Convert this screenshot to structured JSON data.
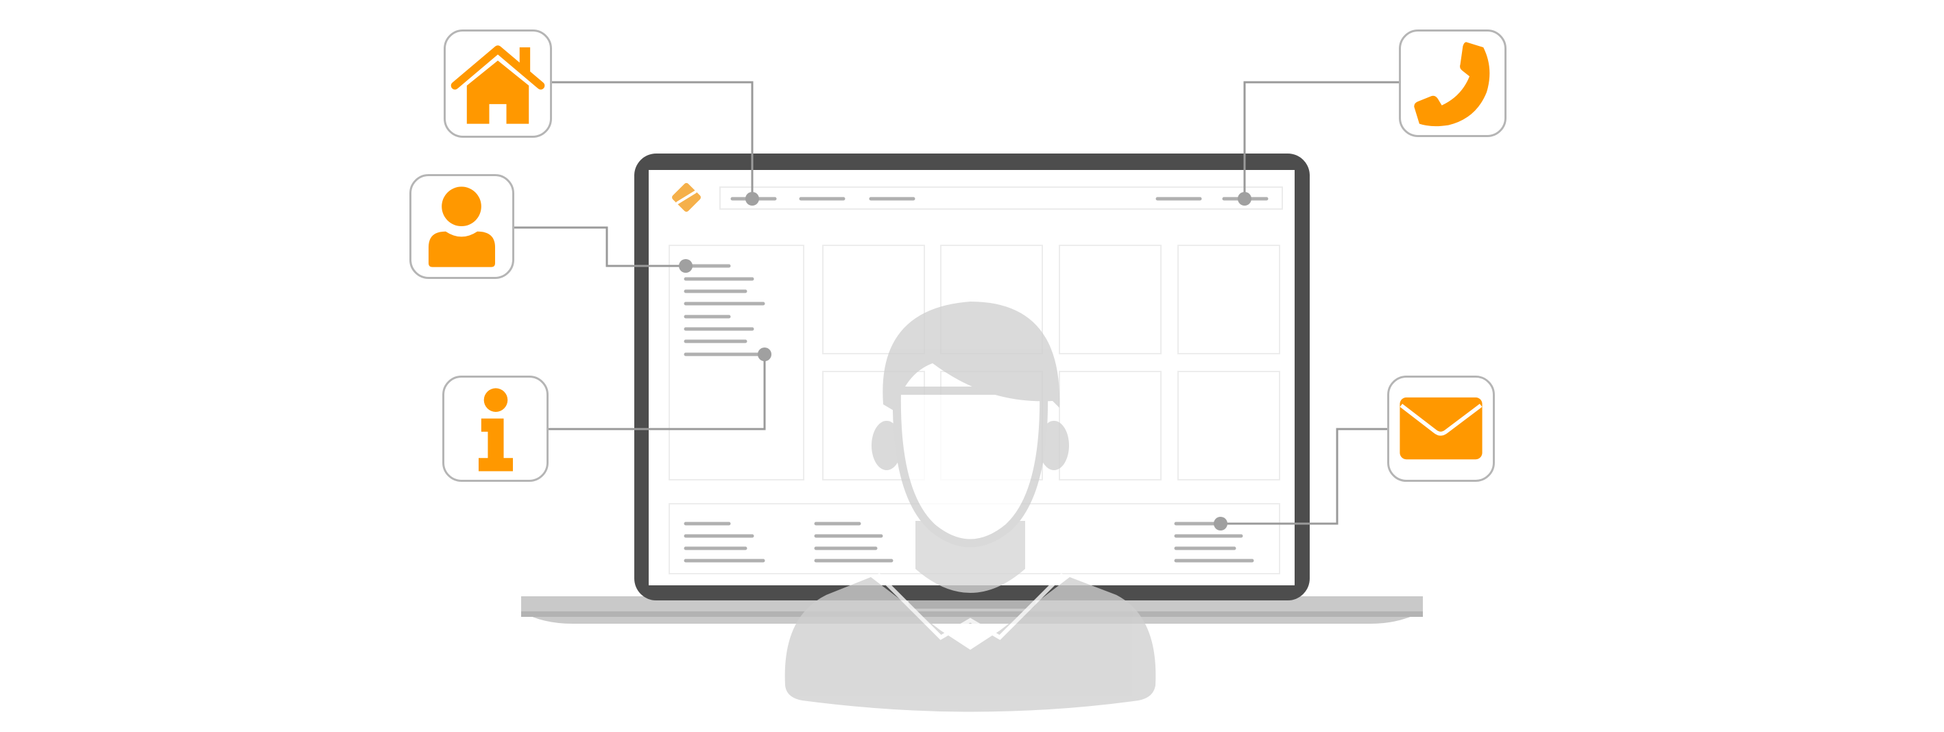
{
  "illustration": {
    "concept": "website-contact-page",
    "colors": {
      "accent": "#ff9800",
      "laptop_frame": "#4d4d4d",
      "laptop_base": "#c9c9c9",
      "laptop_base_shadow": "#a9a9a9",
      "wireframe_line": "#a8a8a8",
      "wireframe_box": "#ededed",
      "person_silhouette": "#cfcfcf",
      "connector_line": "#9a9a9a",
      "icon_border": "#b5b5b5"
    },
    "icons": [
      {
        "name": "home-icon"
      },
      {
        "name": "user-icon"
      },
      {
        "name": "info-icon"
      },
      {
        "name": "phone-icon"
      },
      {
        "name": "mail-icon"
      }
    ]
  }
}
